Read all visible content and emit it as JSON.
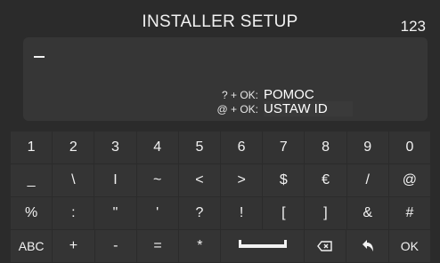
{
  "header": {
    "title": "INSTALLER SETUP",
    "mode_label": "123"
  },
  "input": {
    "text": "_"
  },
  "help": [
    {
      "key": "? + OK:",
      "action": "POMOC"
    },
    {
      "key": "@ + OK:",
      "action": "USTAW ID"
    }
  ],
  "keyboard": {
    "rows": [
      [
        "1",
        "2",
        "3",
        "4",
        "5",
        "6",
        "7",
        "8",
        "9",
        "0"
      ],
      [
        "_",
        "\\",
        "I",
        "~",
        "<",
        ">",
        "$",
        "€",
        "/",
        "@"
      ],
      [
        "%",
        ":",
        "\"",
        "'",
        "?",
        "!",
        "[",
        "]",
        "&",
        "#"
      ]
    ],
    "bottom": {
      "abc": "ABC",
      "plus": "+",
      "minus": "-",
      "equals": "=",
      "star": "*",
      "ok": "OK"
    }
  },
  "icons": [
    "space-icon",
    "backspace-icon",
    "back-arrow-icon"
  ]
}
